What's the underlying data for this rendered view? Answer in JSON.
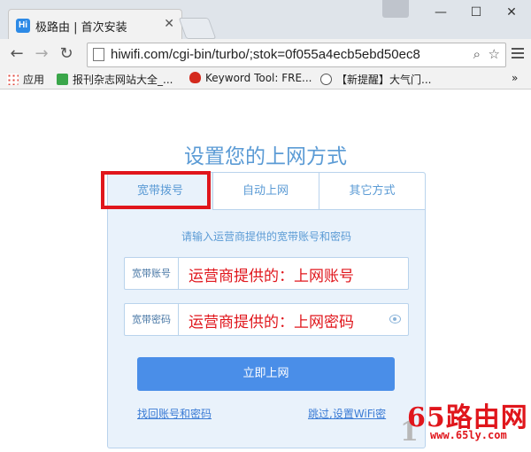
{
  "browser": {
    "tab_title": "极路由 | 首次安装",
    "tab_favicon": "Hi",
    "url": "hiwifi.com/cgi-bin/turbo/;stok=0f055a4ecb5ebd50ec8",
    "bookmarks": [
      {
        "label": "应用",
        "icon": "apps-icon"
      },
      {
        "label": "报刊杂志网站大全_...",
        "icon": "green-c-icon"
      },
      {
        "label": "Keyword Tool: FRE...",
        "icon": "red-flame-icon"
      },
      {
        "label": "【新提醒】大气门...",
        "icon": "wordpress-icon"
      }
    ]
  },
  "page": {
    "title": "设置您的上网方式",
    "tabs": [
      "宽带拨号",
      "自动上网",
      "其它方式"
    ],
    "hint": "请输入运营商提供的宽带账号和密码",
    "fields": [
      {
        "label": "宽带账号",
        "value": "运营商提供的：上网账号"
      },
      {
        "label": "宽带密码",
        "value": "运营商提供的：上网密码"
      }
    ],
    "submit_label": "立即上网",
    "link_left": "找回账号和密码",
    "link_right": "跳过,设置WiFi密"
  },
  "watermark": {
    "main": "65路由网",
    "sub": "www.65ly.com"
  },
  "colors": {
    "accent": "#4a8ee8",
    "highlight_red": "#e0161c",
    "panel_bg": "#e9f2fb"
  }
}
